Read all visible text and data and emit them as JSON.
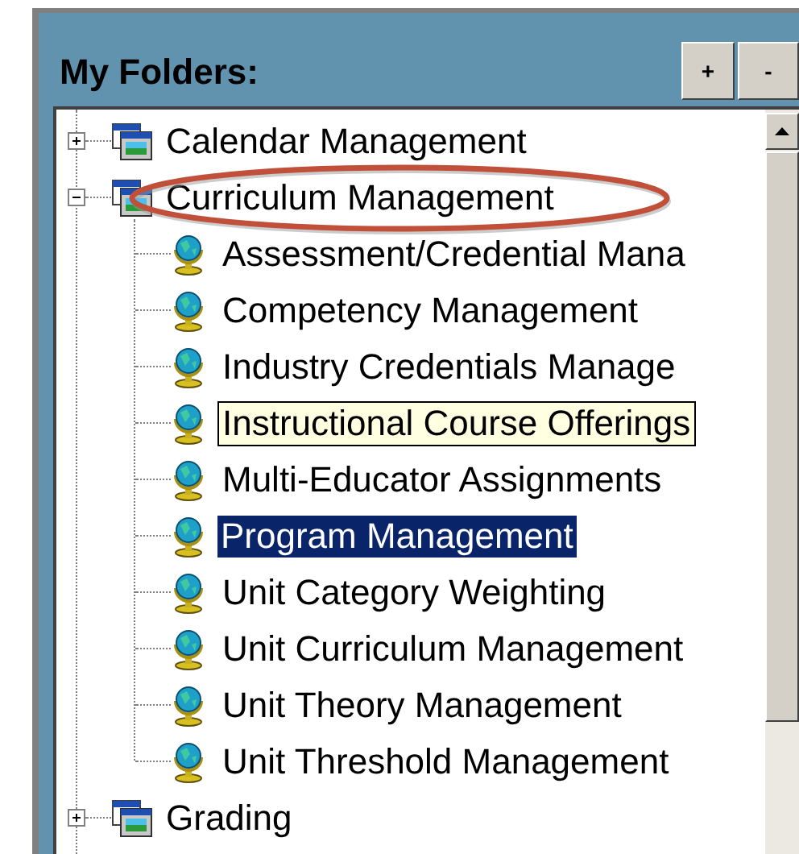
{
  "panel": {
    "title": "My Folders:",
    "buttons": [
      "+",
      "-"
    ]
  },
  "folders": [
    {
      "label": "Calendar Management",
      "expanded": false,
      "annotated": false
    },
    {
      "label": "Curriculum Management",
      "expanded": true,
      "annotated": true,
      "children": [
        {
          "label": "Assessment/Credential Mana",
          "selected": false,
          "tooltip": false
        },
        {
          "label": "Competency Management",
          "selected": false,
          "tooltip": false
        },
        {
          "label": "Industry Credentials Manage",
          "selected": false,
          "tooltip": false
        },
        {
          "label": "Instructional Course Offerings",
          "selected": false,
          "tooltip": true
        },
        {
          "label": "Multi-Educator Assignments",
          "selected": false,
          "tooltip": false
        },
        {
          "label": "Program Management",
          "selected": true,
          "tooltip": false
        },
        {
          "label": "Unit Category Weighting",
          "selected": false,
          "tooltip": false
        },
        {
          "label": "Unit Curriculum Management",
          "selected": false,
          "tooltip": false
        },
        {
          "label": "Unit Theory Management",
          "selected": false,
          "tooltip": false
        },
        {
          "label": "Unit Threshold Management",
          "selected": false,
          "tooltip": false
        }
      ]
    },
    {
      "label": "Grading",
      "expanded": false,
      "annotated": false
    }
  ]
}
